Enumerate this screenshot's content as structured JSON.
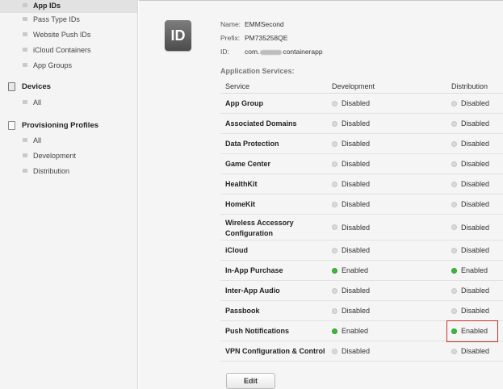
{
  "sidebar": {
    "items": [
      {
        "label": "App IDs",
        "active": true
      },
      {
        "label": "Pass Type IDs"
      },
      {
        "label": "Website Push IDs"
      },
      {
        "label": "iCloud Containers"
      },
      {
        "label": "App Groups"
      }
    ],
    "devices": {
      "title": "Devices",
      "items": [
        {
          "label": "All"
        }
      ]
    },
    "profiles": {
      "title": "Provisioning Profiles",
      "items": [
        {
          "label": "All"
        },
        {
          "label": "Development"
        },
        {
          "label": "Distribution"
        }
      ]
    }
  },
  "app": {
    "icon_text": "ID",
    "name_label": "Name:",
    "name_value": "EMMSecond",
    "prefix_label": "Prefix:",
    "prefix_value": "PM735258QE",
    "id_label": "ID:",
    "id_value_start": "com.",
    "id_value_end": "containerapp"
  },
  "services": {
    "title": "Application Services:",
    "columns": [
      "Service",
      "Development",
      "Distribution"
    ],
    "rows": [
      {
        "name": "App Group",
        "dev": "Disabled",
        "dist": "Disabled"
      },
      {
        "name": "Associated Domains",
        "dev": "Disabled",
        "dist": "Disabled"
      },
      {
        "name": "Data Protection",
        "dev": "Disabled",
        "dist": "Disabled"
      },
      {
        "name": "Game Center",
        "dev": "Disabled",
        "dist": "Disabled"
      },
      {
        "name": "HealthKit",
        "dev": "Disabled",
        "dist": "Disabled"
      },
      {
        "name": "HomeKit",
        "dev": "Disabled",
        "dist": "Disabled"
      },
      {
        "name": "Wireless Accessory Configuration",
        "dev": "Disabled",
        "dist": "Disabled"
      },
      {
        "name": "iCloud",
        "dev": "Disabled",
        "dist": "Disabled"
      },
      {
        "name": "In-App Purchase",
        "dev": "Enabled",
        "dist": "Enabled"
      },
      {
        "name": "Inter-App Audio",
        "dev": "Disabled",
        "dist": "Disabled"
      },
      {
        "name": "Passbook",
        "dev": "Disabled",
        "dist": "Disabled"
      },
      {
        "name": "Push Notifications",
        "dev": "Enabled",
        "dist": "Enabled"
      },
      {
        "name": "VPN Configuration & Control",
        "dev": "Disabled",
        "dist": "Disabled"
      }
    ]
  },
  "edit_label": "Edit",
  "colors": {
    "enabled": "#3cb93c",
    "disabled": "#d9d9d9",
    "highlight": "#c9302c"
  }
}
